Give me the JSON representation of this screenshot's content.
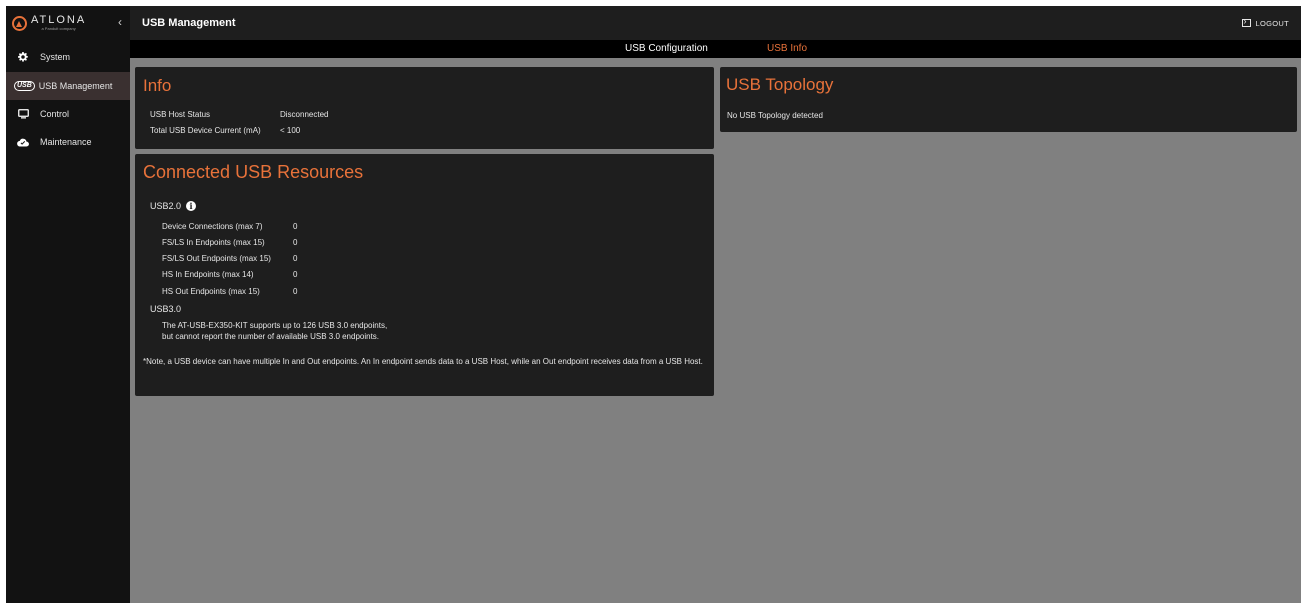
{
  "brand": {
    "name": "ATLONA",
    "tagline": "a Panduit company"
  },
  "sidebar": {
    "items": [
      {
        "label": "System",
        "icon": "gear-icon"
      },
      {
        "label": "USB Management",
        "icon": "usb-icon",
        "badge": "USB",
        "active": true
      },
      {
        "label": "Control",
        "icon": "monitor-icon"
      },
      {
        "label": "Maintenance",
        "icon": "cloud-icon"
      }
    ]
  },
  "header": {
    "title": "USB Management",
    "logout": "LOGOUT"
  },
  "tabs": [
    {
      "label": "USB Configuration",
      "active": false
    },
    {
      "label": "USB Info",
      "active": true
    }
  ],
  "info": {
    "title": "Info",
    "rows": [
      {
        "key": "USB Host Status",
        "value": "Disconnected"
      },
      {
        "key": "Total USB Device Current (mA)",
        "value": "< 100"
      }
    ]
  },
  "topology": {
    "title": "USB Topology",
    "message": "No USB Topology detected"
  },
  "resources": {
    "title": "Connected USB Resources",
    "usb2": {
      "label": "USB2.0",
      "info_glyph": "i",
      "metrics": [
        {
          "key": "Device Connections (max 7)",
          "value": "0"
        },
        {
          "key": "FS/LS In Endpoints (max 15)",
          "value": "0"
        },
        {
          "key": "FS/LS Out Endpoints (max 15)",
          "value": "0"
        },
        {
          "key": "HS In Endpoints (max 14)",
          "value": "0"
        },
        {
          "key": "HS Out Endpoints (max 15)",
          "value": "0"
        }
      ]
    },
    "usb3": {
      "label": "USB3.0",
      "line1": "The AT-USB-EX350-KIT supports up to 126 USB 3.0 endpoints,",
      "line2": "but cannot report the number of available USB 3.0 endpoints."
    },
    "note": "*Note, a USB device can have multiple In and Out endpoints. An In endpoint sends data to a USB Host, while an Out endpoint receives data from a USB Host."
  },
  "colors": {
    "accent": "#e8723a",
    "sidebar_bg": "#121212",
    "panel_bg": "#1e1e1e",
    "content_bg": "#808080",
    "active_nav_bg": "#3a3030"
  }
}
